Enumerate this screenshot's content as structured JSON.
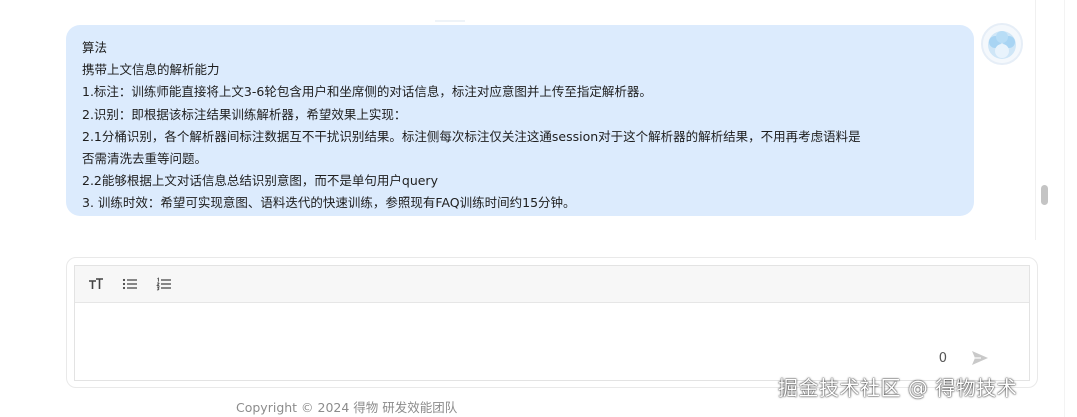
{
  "message": {
    "lines": [
      "算法",
      "携带上文信息的解析能力",
      "1.标注：训练师能直接将上文3-6轮包含用户和坐席侧的对话信息，标注对应意图并上传至指定解析器。",
      "2.识别：即根据该标注结果训练解析器，希望效果上实现：",
      "2.1分桶识别，各个解析器间标注数据互不干扰识别结果。标注侧每次标注仅关注这通session对于这个解析器的解析结果，不用再考虑语料是",
      "否需清洗去重等问题。",
      "2.2能够根据上文对话信息总结识别意图，而不是单句用户query",
      "3. 训练时效：希望可实现意图、语料迭代的快速训练，参照现有FAQ训练时间约15分钟。"
    ]
  },
  "composer": {
    "toolbar": {
      "icons": [
        "text-size-icon",
        "bullet-list-icon",
        "numbered-list-icon"
      ]
    },
    "char_count": "0",
    "send_icon": "send-icon"
  },
  "footer": {
    "copyright": "Copyright © 2024 得物 研发效能团队"
  },
  "watermark": "掘金技术社区 @ 得物技术",
  "colors": {
    "bubble_bg": "#dcebfd",
    "avatar_accent": "#9fd0f2"
  }
}
